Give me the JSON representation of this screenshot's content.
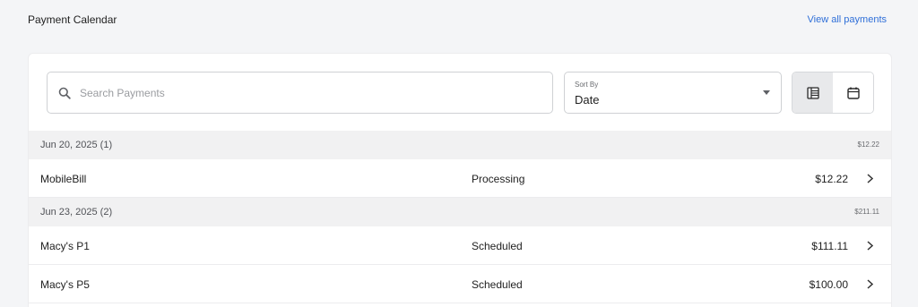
{
  "header": {
    "title": "Payment Calendar",
    "view_all_label": "View all payments"
  },
  "search": {
    "placeholder": "Search Payments",
    "value": ""
  },
  "sort": {
    "caption": "Sort By",
    "value": "Date"
  },
  "view_toggle": {
    "options": [
      "list-view",
      "calendar-view"
    ],
    "selected": "list-view"
  },
  "groups": [
    {
      "date_label": "Jun 20, 2025 (1)",
      "total": "$12.22",
      "payments": [
        {
          "name": "MobileBill",
          "status": "Processing",
          "amount": "$12.22"
        }
      ]
    },
    {
      "date_label": "Jun 23, 2025 (2)",
      "total": "$211.11",
      "payments": [
        {
          "name": "Macy's P1",
          "status": "Scheduled",
          "amount": "$111.11"
        },
        {
          "name": "Macy's P5",
          "status": "Scheduled",
          "amount": "$100.00"
        }
      ]
    }
  ],
  "colors": {
    "link": "#2f6fd8",
    "page_background": "#f4f5f7",
    "group_header_background": "#f1f1f2"
  }
}
